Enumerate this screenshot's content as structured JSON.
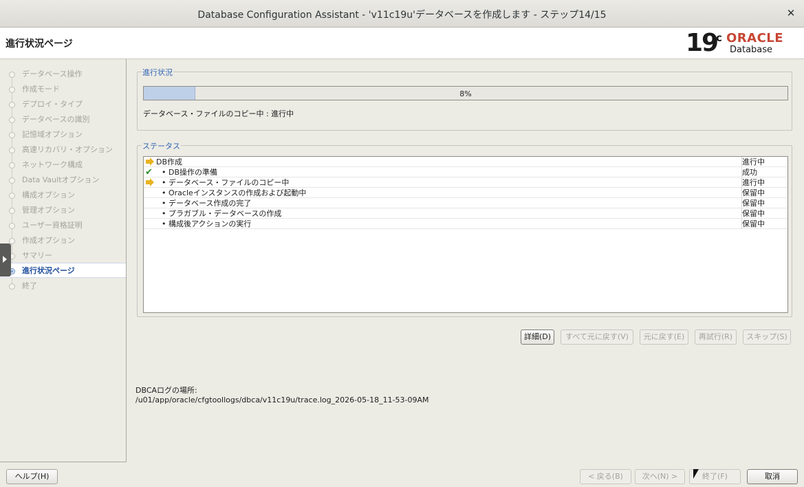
{
  "window": {
    "title": "Database Configuration Assistant - 'v11c19u'データベースを作成します - ステップ14/15",
    "close_glyph": "✕"
  },
  "header": {
    "page_title": "進行状況ページ",
    "logo": {
      "version": "19",
      "superscript": "c",
      "brand": "ORACLE",
      "product": "Database"
    }
  },
  "sidebar": {
    "steps": [
      {
        "label": "データベース操作"
      },
      {
        "label": "作成モード"
      },
      {
        "label": "デプロイ・タイプ"
      },
      {
        "label": "データベースの識別"
      },
      {
        "label": "記憶域オプション"
      },
      {
        "label": "高速リカバリ・オプション"
      },
      {
        "label": "ネットワーク構成"
      },
      {
        "label": "Data Vaultオプション"
      },
      {
        "label": "構成オプション"
      },
      {
        "label": "管理オプション"
      },
      {
        "label": "ユーザー資格証明"
      },
      {
        "label": "作成オプション"
      },
      {
        "label": "サマリー"
      },
      {
        "label": "進行状況ページ",
        "current": true
      },
      {
        "label": "終了"
      }
    ]
  },
  "progress": {
    "legend": "進行状況",
    "percent_value": 8,
    "percent_label": "8%",
    "message": "データベース・ファイルのコピー中 : 進行中"
  },
  "status": {
    "legend": "ステータス",
    "rows": [
      {
        "icon": "arrow-icon",
        "task": "DB作成",
        "status": "進行中"
      },
      {
        "icon": "check-icon",
        "task": "• DB操作の準備",
        "status": "成功"
      },
      {
        "icon": "arrow-icon",
        "task": "• データベース・ファイルのコピー中",
        "status": "進行中"
      },
      {
        "icon": "",
        "task": "• Oracleインスタンスの作成および起動中",
        "status": "保留中"
      },
      {
        "icon": "",
        "task": "• データベース作成の完了",
        "status": "保留中"
      },
      {
        "icon": "",
        "task": "• プラガブル・データベースの作成",
        "status": "保留中"
      },
      {
        "icon": "",
        "task": "• 構成後アクションの実行",
        "status": "保留中"
      }
    ]
  },
  "actions": {
    "details": "詳細(D)",
    "revert_all": "すべて元に戻す(V)",
    "revert": "元に戻す(E)",
    "retry": "再試行(R)",
    "skip": "スキップ(S)"
  },
  "log": {
    "title": "DBCAログの場所:",
    "path": "/u01/app/oracle/cfgtoollogs/dbca/v11c19u/trace.log_2026-05-18_11-53-09AM"
  },
  "footer": {
    "help": "ヘルプ(H)",
    "back": "< 戻る(B)",
    "next": "次へ(N) >",
    "finish": "終了(F)",
    "cancel": "取消"
  },
  "colors": {
    "accent_blue": "#3567b5",
    "oracle_red": "#c74634",
    "progress_fill": "#bed0e8",
    "in_progress_arrow": "#e8b321",
    "success_check": "#2d8a2d"
  }
}
